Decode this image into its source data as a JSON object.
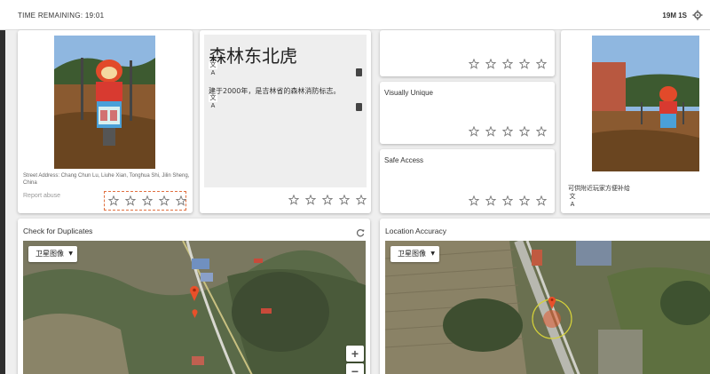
{
  "header": {
    "timer_label": "TIME REMAINING: 19:01",
    "timer_short": "19M 1S",
    "settings_icon": "gear-icon"
  },
  "submission": {
    "address": "Street Address: Chang Chun Lu, Liuhe Xian, Tonghua Shi, Jilin Sheng, China",
    "report_label": "Report abuse",
    "title_zh": "森林东北虎",
    "description_zh": "建于2000年，是吉林省的森林消防标志。",
    "supporting_caption_zh": "可供附近玩家方便补给",
    "translate_icon": "文A"
  },
  "criteria": {
    "visually_unique": "Visually Unique",
    "safe_access": "Safe Access"
  },
  "sections": {
    "duplicates_title": "Check for Duplicates",
    "location_title": "Location Accuracy"
  },
  "map": {
    "type_label": "卫星图像",
    "zoom_in": "+",
    "zoom_out": "−"
  },
  "colors": {
    "accent_dashed": "#e07040",
    "marker": "#e8502a",
    "accuracy_circle": "#d6d23a"
  }
}
